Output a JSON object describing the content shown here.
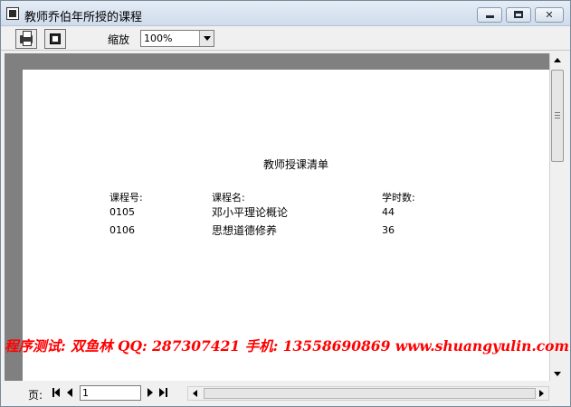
{
  "window": {
    "title": "教师乔伯年所授的课程"
  },
  "toolbar": {
    "zoom_label": "缩放",
    "zoom_value": "100%"
  },
  "report": {
    "title": "教师授课清单",
    "headers": {
      "code": "课程号:",
      "name": "课程名:",
      "hours": "学时数:"
    },
    "rows": [
      {
        "code": "0105",
        "name": "邓小平理论概论",
        "hours": "44"
      },
      {
        "code": "0106",
        "name": "思想道德修养",
        "hours": "36"
      }
    ]
  },
  "watermark": {
    "text": "程序测试: 双鱼林   QQ: 287307421 手机: 13558690869   www.shuangyulin.com"
  },
  "status": {
    "page_label": "页:",
    "page_value": "1"
  },
  "colors": {
    "watermark": "#ff0000",
    "viewport_bg": "#808080"
  },
  "icons": [
    "app-icon",
    "minimize-icon",
    "maximize-icon",
    "close-icon",
    "print-icon",
    "export-icon",
    "first-page-icon",
    "prev-page-icon",
    "next-page-icon",
    "last-page-icon"
  ]
}
